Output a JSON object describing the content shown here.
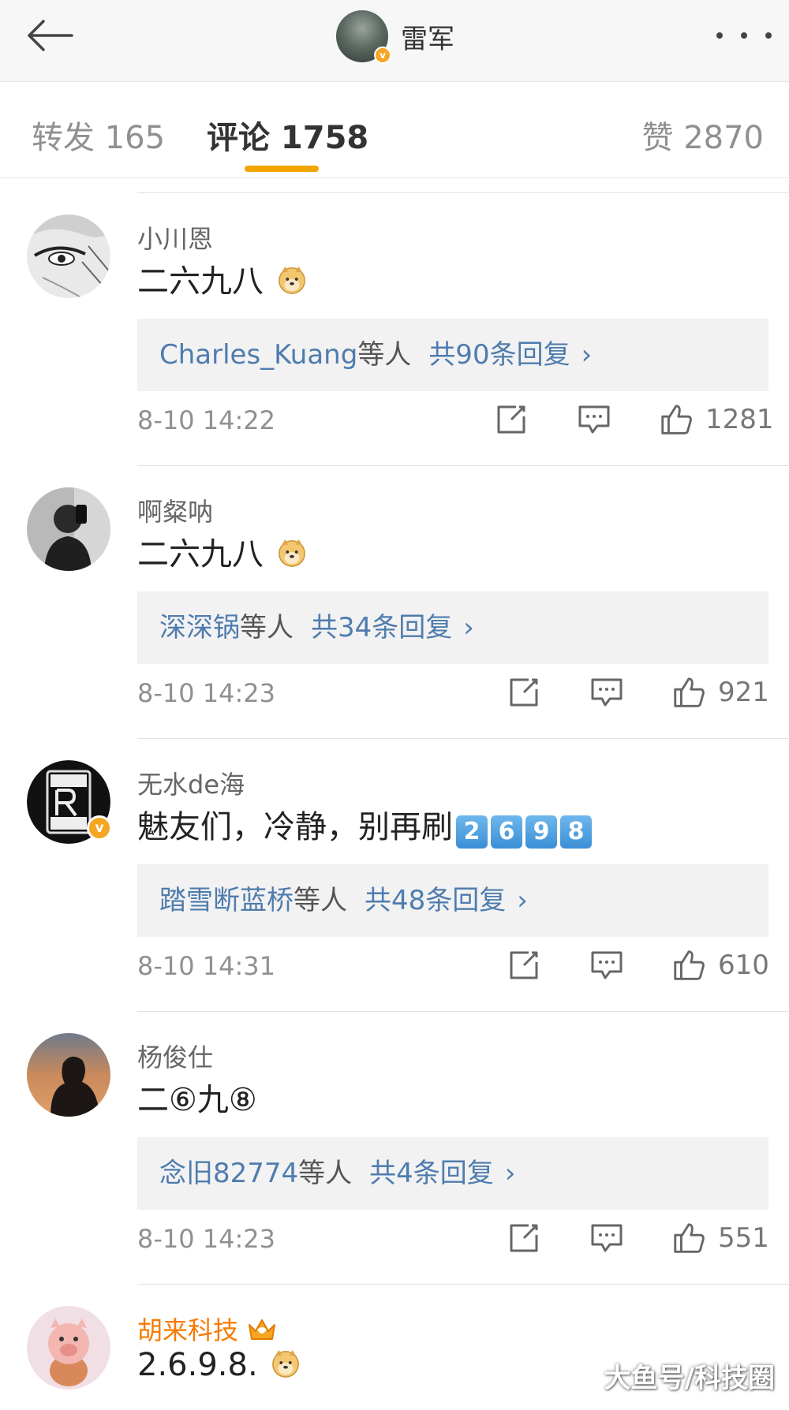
{
  "header": {
    "back_icon": "back-arrow-icon",
    "author_name": "雷军",
    "more_icon": "more-dots-icon",
    "verified_badge": "v"
  },
  "tabs": {
    "forward": "转发 165",
    "comments": "评论 1758",
    "likes": "赞 2870",
    "active_color": "#f2a500"
  },
  "comments": [
    {
      "user": "小川恩",
      "text": "二六九八",
      "emoji": "doge",
      "reply_users": "Charles_Kuang",
      "reply_etc": "等人",
      "reply_count": "共90条回复",
      "reply_chevron": "›",
      "time": "8-10 14:22",
      "likes": "1281"
    },
    {
      "user": "啊粲呐",
      "text": "二六九八",
      "emoji": "doge",
      "reply_users": "深深锅",
      "reply_etc": "等人",
      "reply_count": "共34条回复",
      "reply_chevron": "›",
      "time": "8-10 14:23",
      "likes": "921"
    },
    {
      "user": "无水de海",
      "text": "魅友们，冷静，别再刷",
      "keycaps": [
        "2",
        "6",
        "9",
        "8"
      ],
      "verified": "v",
      "reply_users": "踏雪断蓝桥",
      "reply_etc": "等人",
      "reply_count": "共48条回复",
      "reply_chevron": "›",
      "time": "8-10 14:31",
      "likes": "610"
    },
    {
      "user": "杨俊仕",
      "text": "二⑥九⑧",
      "reply_users": "念旧82774",
      "reply_etc": "等人",
      "reply_count": "共4条回复",
      "reply_chevron": "›",
      "time": "8-10 14:23",
      "likes": "551"
    },
    {
      "user": "胡来科技",
      "text": "2.6.9.8.",
      "emoji": "doge",
      "member_icon": "crown-icon",
      "user_color": "#f77a00"
    }
  ],
  "watermark": "大鱼号/科技圈",
  "colors": {
    "link": "#4f7cae",
    "badge": "#f5a623",
    "reply_bg": "#f2f2f2"
  }
}
